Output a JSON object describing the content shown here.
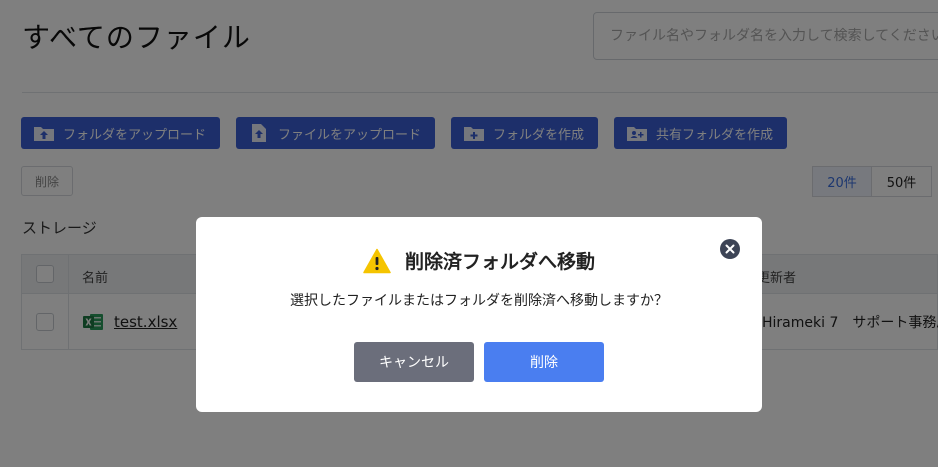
{
  "page": {
    "title": "すべてのファイル",
    "search_placeholder": "ファイル名やフォルダ名を入力して検索してください"
  },
  "toolbar": {
    "upload_folder": "フォルダをアップロード",
    "upload_file": "ファイルをアップロード",
    "create_folder": "フォルダを作成",
    "create_shared_folder": "共有フォルダを作成"
  },
  "actions": {
    "delete": "削除"
  },
  "pagination": {
    "options": [
      "20件",
      "50件"
    ],
    "selected": "20件"
  },
  "storage": {
    "label": "ストレージ"
  },
  "table": {
    "columns": {
      "name": "名前",
      "updater": "更新者"
    },
    "rows": [
      {
        "name": "test.xlsx",
        "updater": "Hirameki 7　サポート事務局"
      }
    ]
  },
  "modal": {
    "title": "削除済フォルダへ移動",
    "message": "選択したファイルまたはフォルダを削除済へ移動しますか？",
    "cancel": "キャンセル",
    "confirm": "削除"
  },
  "colors": {
    "primary": "#3a5fd4",
    "confirm": "#4a7ef0",
    "cancel": "#6b6e7b",
    "warning": "#f5c400",
    "excel": "#1f7a45"
  }
}
